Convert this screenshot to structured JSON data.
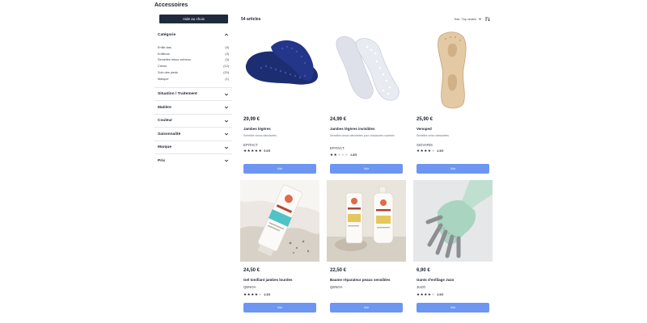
{
  "page": {
    "title": "Accessoires",
    "help_button": "Aide au choix"
  },
  "filters": {
    "category": {
      "title": "Catégorie",
      "items": [
        {
          "label": "Enfile-bas",
          "count": "(9)"
        },
        {
          "label": "Enfileurs",
          "count": "(3)"
        },
        {
          "label": "Semelles retour veineux",
          "count": "(3)"
        },
        {
          "label": "Crème",
          "count": "(12)"
        },
        {
          "label": "Soin des pieds",
          "count": "(20)"
        },
        {
          "label": "Masque",
          "count": "(1)"
        }
      ]
    },
    "collapsed": [
      "Situation / Traitement",
      "Matière",
      "Couleur",
      "Saisonnalité",
      "Marque",
      "Prix"
    ]
  },
  "results": {
    "count_label": "54 articles",
    "sort_label": "Trier: Top ventes",
    "sort_icon": "sort-icon"
  },
  "products": [
    {
      "price": "29,99 €",
      "name": "Jambes légères",
      "desc": "Semelles venos stimulantes",
      "brand": "EPITACT",
      "rating": 5,
      "rating_label": "5.0/5",
      "button": "Voir",
      "image": "blue-insoles"
    },
    {
      "price": "24,99 €",
      "name": "Jambes légères invisibles",
      "desc": "Semelles venos stimulantes pour chaussures ouvertes",
      "brand": "EPITACT",
      "rating": 2,
      "rating_label": "2.8/5",
      "button": "Voir",
      "image": "clear-insoles"
    },
    {
      "price": "25,90 €",
      "name": "Venoped",
      "desc": "Semelles veino stimulantes",
      "brand": "SIGVARIS",
      "rating": 4.5,
      "rating_label": "4.5/5",
      "button": "Voir",
      "image": "beige-insole"
    },
    {
      "price": "24,50 €",
      "name": "Gel tonifiant jambes lourdes",
      "desc": "",
      "brand": "QENOA",
      "rating": 4,
      "rating_label": "4.3/5",
      "button": "Voir",
      "image": "gel-tube"
    },
    {
      "price": "22,50 €",
      "name": "Baume réparateur peaux sensibles",
      "desc": "",
      "brand": "QENOA",
      "rating": 4.5,
      "rating_label": "4.5/5",
      "button": "Voir",
      "image": "balm-bottles"
    },
    {
      "price": "6,90 €",
      "name": "Gants d'enfilage Juzo",
      "desc": "",
      "brand": "JUZO",
      "rating": 4.5,
      "rating_label": "4.5/5",
      "button": "Voir",
      "image": "green-glove"
    }
  ]
}
